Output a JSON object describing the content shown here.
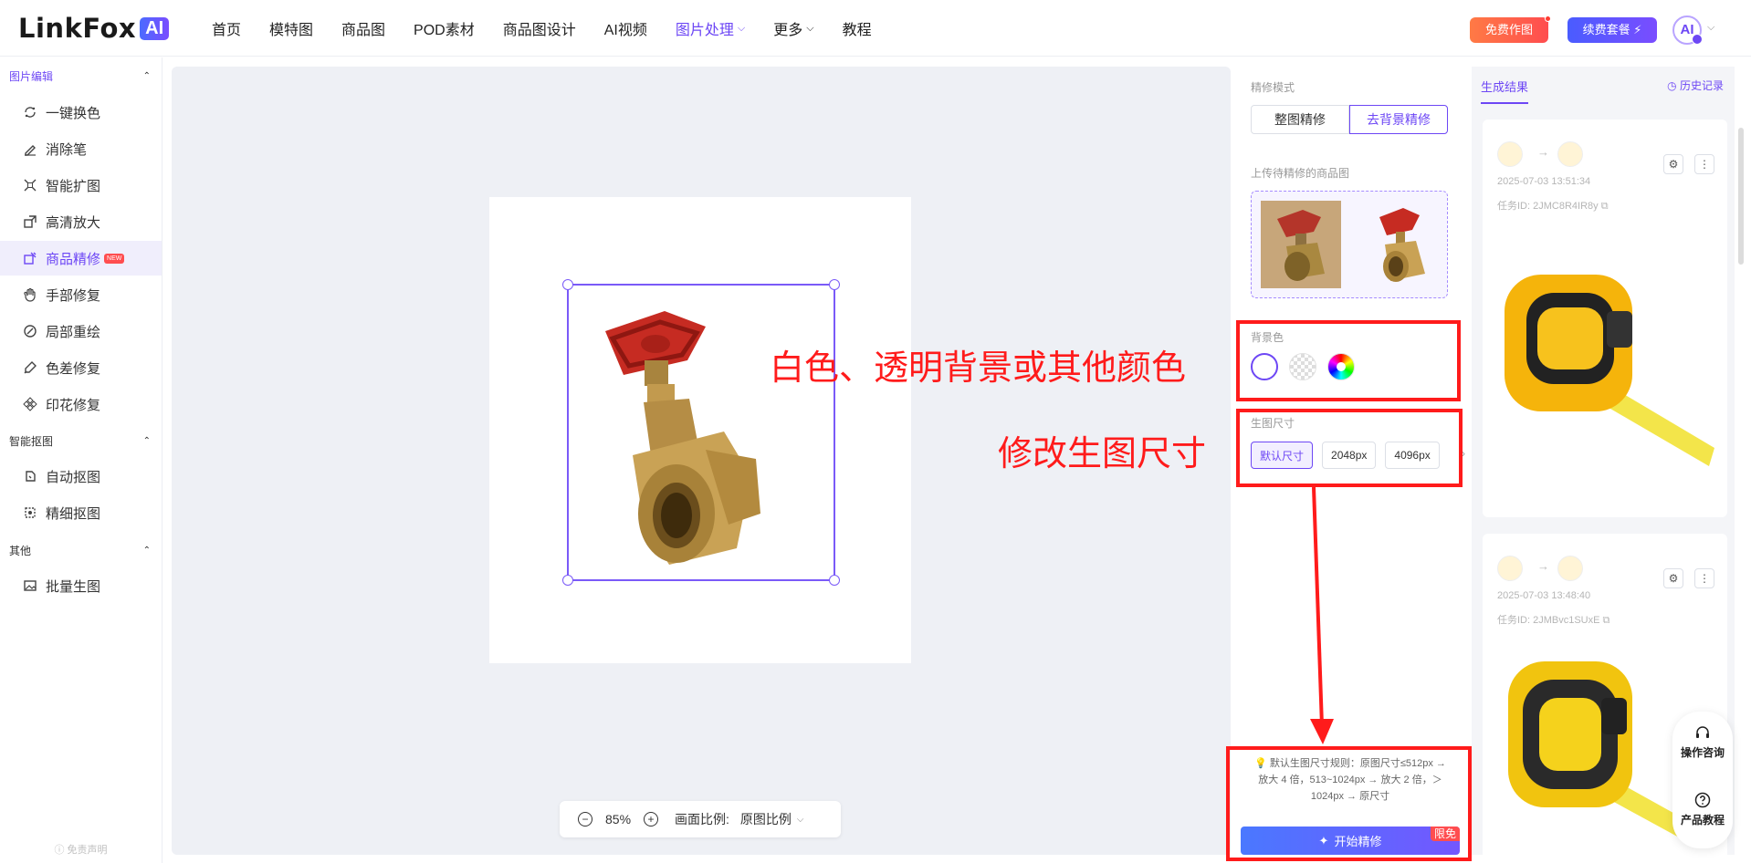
{
  "brand": {
    "name": "LinkFox",
    "ai": "AI"
  },
  "nav": {
    "items": [
      {
        "label": "首页"
      },
      {
        "label": "模特图"
      },
      {
        "label": "商品图"
      },
      {
        "label": "POD素材"
      },
      {
        "label": "商品图设计"
      },
      {
        "label": "AI视频"
      },
      {
        "label": "图片处理",
        "active": true
      },
      {
        "label": "更多"
      },
      {
        "label": "教程"
      }
    ],
    "free_btn": "免费作图",
    "renew_btn": "续费套餐 ⚡",
    "avatar": "AI"
  },
  "sidebar": {
    "sections": [
      {
        "title": "图片编辑",
        "items": [
          "一键换色",
          "消除笔",
          "智能扩图",
          "高清放大",
          "商品精修",
          "手部修复",
          "局部重绘",
          "色差修复",
          "印花修复"
        ]
      },
      {
        "title": "智能抠图",
        "items": [
          "自动抠图",
          "精细抠图"
        ]
      },
      {
        "title": "其他",
        "items": [
          "批量生图"
        ]
      }
    ],
    "active_item": "商品精修",
    "new_badge": "NEW",
    "disclaimer": "免责声明"
  },
  "canvas": {
    "zoom": "85%",
    "ratio_label": "画面比例:",
    "ratio_value": "原图比例"
  },
  "settings": {
    "mode_label": "精修模式",
    "modes": [
      "整图精修",
      "去背景精修"
    ],
    "active_mode": "去背景精修",
    "upload_label": "上传待精修的商品图",
    "bg_label": "背景色",
    "size_label": "生图尺寸",
    "sizes": [
      "默认尺寸",
      "2048px",
      "4096px"
    ],
    "active_size": "默认尺寸",
    "rule_text": "💡 默认生图尺寸规则：原图尺寸≤512px → 放大 4 倍，513~1024px → 放大 2 倍，＞1024px → 原尺寸",
    "start_btn": "开始精修",
    "limit_badge": "限免"
  },
  "annotations": {
    "bg_note": "白色、透明背景或其他颜色",
    "size_note": "修改生图尺寸",
    "color": "#ff1b1b"
  },
  "results": {
    "tab": "生成结果",
    "history": "历史记录",
    "cards": [
      {
        "time": "2025-07-03 13:51:34",
        "id": "任务ID: 2JMC8R4IR8y"
      },
      {
        "time": "2025-07-03 13:48:40",
        "id": "任务ID: 2JMBvc1SUxE"
      }
    ]
  },
  "float": {
    "consult": "操作咨询",
    "tutorial": "产品教程"
  },
  "colors": {
    "accent": "#6d47f5",
    "annotation": "#ff1b1b"
  }
}
